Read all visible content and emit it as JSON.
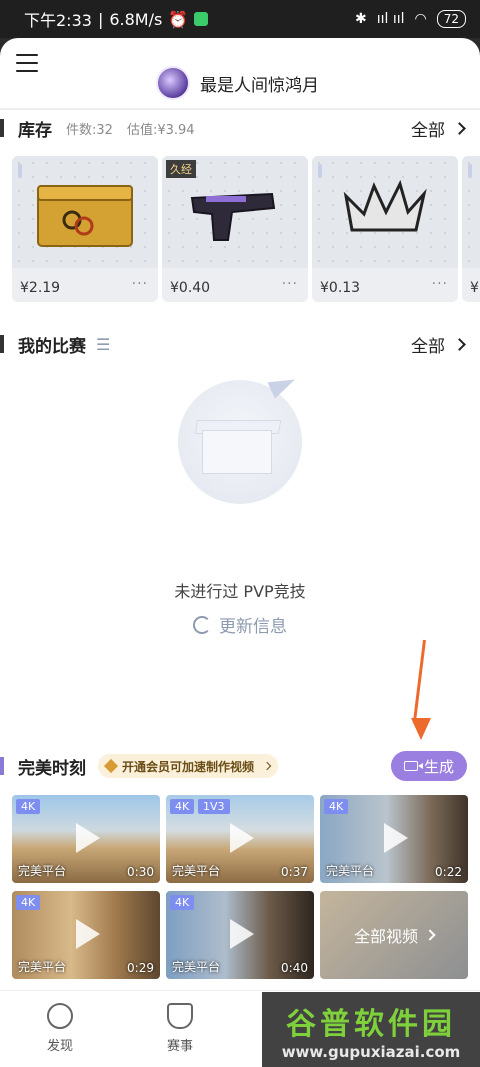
{
  "status_bar": {
    "time": "下午2:33",
    "speed": "6.8M/s",
    "signal": "ııl ııl",
    "wifi": "◠",
    "bluetooth": "✱",
    "battery": "72"
  },
  "header": {
    "username": "最是人间惊鸿月"
  },
  "inventory": {
    "title": "库存",
    "count_text": "件数:32",
    "value_text": "估值:¥3.94",
    "more_label": "全部",
    "items": [
      {
        "price": "¥2.19",
        "tag": "",
        "name": "weapon-case"
      },
      {
        "price": "¥0.40",
        "tag": "久经",
        "name": "pistol"
      },
      {
        "price": "¥0.13",
        "tag": "",
        "name": "crown-sticker"
      },
      {
        "price": "¥",
        "tag": "",
        "name": "partial-item"
      }
    ]
  },
  "matches": {
    "title": "我的比赛",
    "more_label": "全部",
    "empty_text": "未进行过 PVP竞技",
    "refresh_label": "更新信息"
  },
  "moments": {
    "title": "完美时刻",
    "vip_label": "开通会员可加速制作视频",
    "generate_label": "生成",
    "all_videos_label": "全部视频",
    "videos": [
      {
        "badges": [
          "4K"
        ],
        "caption": "完美平台",
        "duration": "0:30"
      },
      {
        "badges": [
          "4K",
          "1V3"
        ],
        "caption": "完美平台",
        "duration": "0:37"
      },
      {
        "badges": [
          "4K"
        ],
        "caption": "完美平台",
        "duration": "0:22"
      },
      {
        "badges": [
          "4K"
        ],
        "caption": "完美平台",
        "duration": "0:29"
      },
      {
        "badges": [
          "4K"
        ],
        "caption": "完美平台",
        "duration": "0:40"
      }
    ]
  },
  "bottom_nav": {
    "items": [
      {
        "label": "发现"
      },
      {
        "label": "赛事"
      }
    ]
  },
  "watermark": {
    "title": "谷普软件园",
    "url": "www.gupuxiazai.com"
  }
}
